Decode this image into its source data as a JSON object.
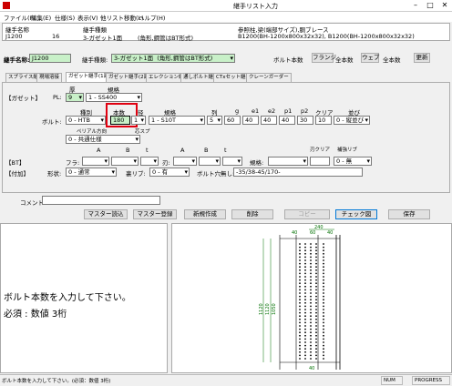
{
  "window": {
    "title": "継手リスト入力",
    "minimize": "–",
    "maximize": "□",
    "close": "✕"
  },
  "menu": [
    "ファイル(F)",
    "編集(E)",
    "仕様(S)",
    "表示(V)",
    "他リスト移動(L)",
    "ヘルプ(H)"
  ],
  "header": {
    "col_name": "継手名称",
    "col_type": "継手種類",
    "col_ref": "参照柱,梁(端部サイズ),胴ブレース",
    "row_name": "J1200",
    "row_count": "16",
    "row_type": "3-ガゼット1面",
    "row_desc": "(角形,鋼管はBT形式)",
    "row_ref": "B1200(BH-1200x800x32x32), B1200(BH-1200x800x32x32)"
  },
  "form": {
    "name_label": "継手名称:",
    "name_value": "J1200",
    "type_label": "継手種類:",
    "type_value": "3-ガゼット1面",
    "type_desc": "(角形,鋼管はBT形式)",
    "bolt_label": "ボルト本数",
    "flange_btn": "フランジ",
    "flange_val": "全本数",
    "web_btn": "ウェブ",
    "web_val": "全本数",
    "update_btn": "更新"
  },
  "tabs": [
    "スプライス継手",
    "現場溶接",
    "ガゼット継手(1面)",
    "ガゼット継手(2面)",
    "エレクション継手",
    "通しボルト継手",
    "CTxセット継手",
    "クレーンガーダー"
  ],
  "gusset": {
    "section_label": "【ガゼット】",
    "thk_header": "厚",
    "spec_header": "規格",
    "pl_label": "PL:",
    "pl_thk": "9",
    "pl_spec": "1 - SS400",
    "kind_header": "種別",
    "count_header": "本数",
    "diam_header": "径",
    "spec2_header": "規格",
    "row_header": "列",
    "g_header": "g",
    "e1_header": "e1",
    "e2_header": "e2",
    "p1_header": "p1",
    "p2_header": "p2",
    "clear_header": "クリア",
    "order_header": "並び",
    "bolt_label": "ボルト:",
    "bolt_kind": "0 - HTB",
    "bolt_count": "180",
    "bolt_diam": "1",
    "bolt_spec": "1 - S10T",
    "bolt_rows": "5",
    "g": "60",
    "e1": "40",
    "e2": "40",
    "p1": "40",
    "p2": "30",
    "clear": "10",
    "order": "0 - 縦並び",
    "pitch_label": "ペリアル方向",
    "center_label": "芯スプ",
    "pitch_value": "0 - 共通仕様"
  },
  "bt": {
    "a_header": "A",
    "b_header": "B",
    "t_header": "t",
    "clear_header": "刃クリア",
    "rib_header": "補強リブ",
    "label": "【BT】",
    "flange_label": "フラ:",
    "blade_label": "刃:",
    "spec_label": "規格:",
    "rib_value": "0 - 無"
  },
  "attach": {
    "label": "【付加】",
    "shape_label": "形状:",
    "shape_value": "0 - 通常",
    "backrib_label": "裏リブ:",
    "backrib_value": "0 - 有",
    "hole_label": "ボルト穴無し:",
    "hole_value": "-35/38-45/170-"
  },
  "comment_label": "コメント:",
  "actions": [
    "マスター読込",
    "マスター登録",
    "新規作成",
    "削除",
    "コピー",
    "チェック図",
    "保存"
  ],
  "message": {
    "line1": "ボルト本数を入力して下さい。",
    "line2": "必須 :  数値 3桁"
  },
  "drawing": {
    "dim_top": [
      "40",
      "60",
      "40",
      "240"
    ],
    "dim_left": [
      "1120",
      "1120",
      "1050"
    ],
    "dim_bottom": [
      "40"
    ]
  },
  "status": {
    "text": "ボルト本数を入力して下さい。(必須：数値 3桁)",
    "num": "NUM",
    "progress": "PROGRESS"
  }
}
